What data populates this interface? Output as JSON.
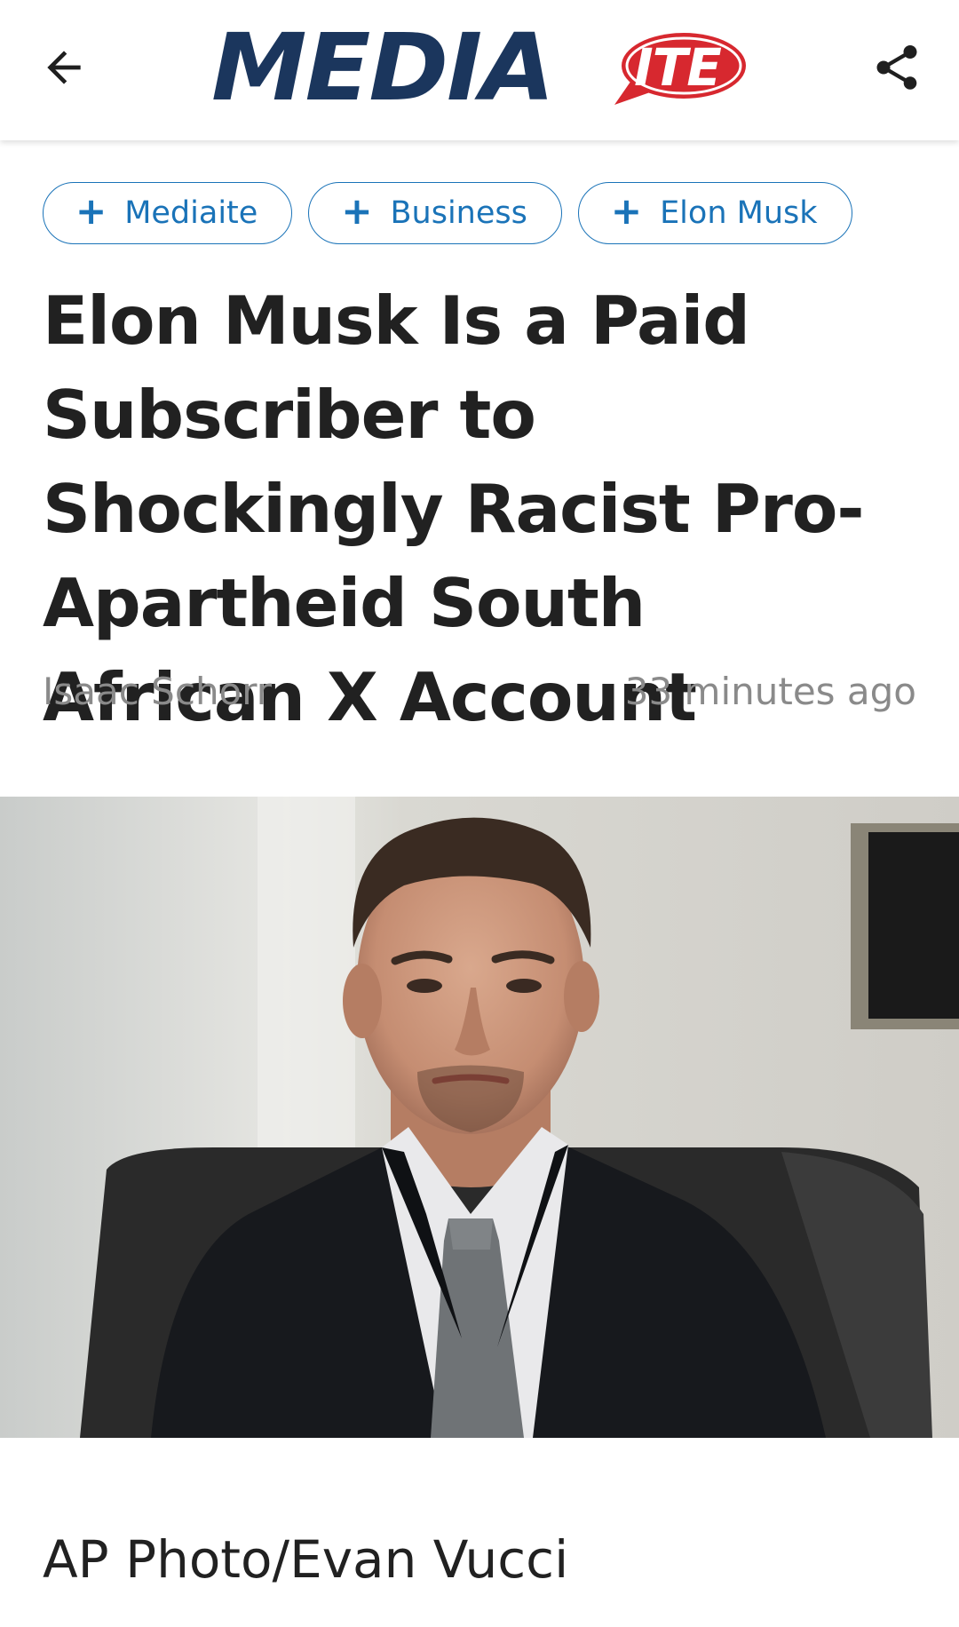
{
  "header": {
    "logo_word": "MEDIA",
    "logo_badge": "ITE",
    "back_icon": "arrow-left-icon",
    "share_icon": "share-icon",
    "brand_navy": "#1b365d",
    "brand_red": "#d7282f"
  },
  "tags": [
    {
      "label": "Mediaite",
      "icon": "plus-icon"
    },
    {
      "label": "Business",
      "icon": "plus-icon"
    },
    {
      "label": "Elon Musk",
      "icon": "plus-icon"
    }
  ],
  "article": {
    "headline": "Elon Musk Is a Paid Subscriber to Shockingly Racist Pro-Apartheid South African X Account",
    "author": "Isaac Schorr",
    "time": "33 minutes ago",
    "photo_caption": "AP Photo/Evan Vucci"
  },
  "colors": {
    "tag_blue": "#1a73b8",
    "meta_gray": "#8a8a8a"
  }
}
